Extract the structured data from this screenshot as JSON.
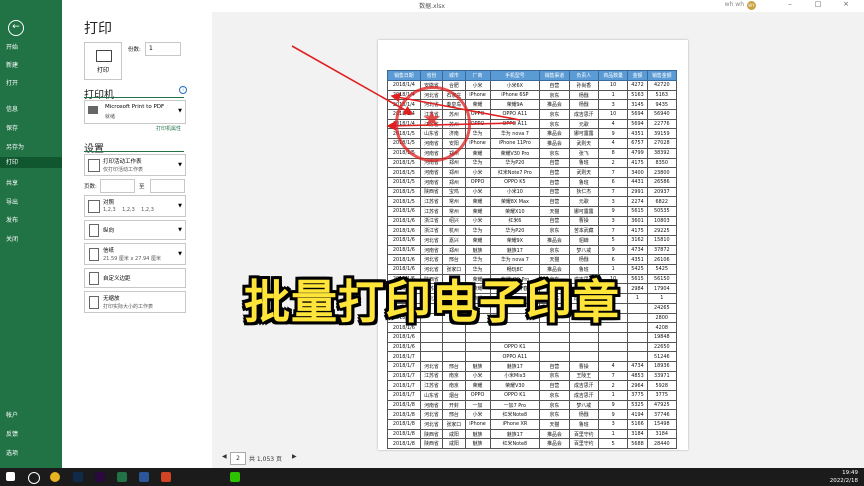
{
  "window": {
    "title": "数据.xlsx",
    "user": "wh wh",
    "avatar": "WY"
  },
  "sidebar": {
    "items": [
      "开始",
      "新建",
      "打开",
      "信息",
      "保存",
      "另存为",
      "打印",
      "共享",
      "导出",
      "发布",
      "关闭",
      "帐户",
      "反馈",
      "选项"
    ]
  },
  "print": {
    "title": "打印",
    "copies_label": "份数:",
    "copies_value": "1",
    "print_button": "打印",
    "printer_section": "打印机",
    "printer_name": "Microsoft Print to PDF",
    "printer_status": "就绪",
    "printer_props": "打印机属性",
    "settings_section": "设置",
    "setting1_main": "打印活动工作表",
    "setting1_sub": "仅打印活动工作表",
    "pages_label": "页数:",
    "pages_to": "至",
    "collate_main": "对照",
    "collate_sub": "1,2,3    1,2,3    1,2,3",
    "orientation": "纵向",
    "paper_main": "信纸",
    "paper_sub": "21.59 厘米 x 27.94 厘米",
    "margins": "自定义边距",
    "scale_main": "无缩放",
    "scale_sub": "打印实际大小的工作表"
  },
  "preview": {
    "page_current": "2",
    "page_total": "共 1,053 页",
    "headers": [
      "销售日期",
      "省份",
      "城市",
      "厂商",
      "手机型号",
      "销售渠道",
      "负责人",
      "商品数量",
      "金额",
      "销售金额"
    ],
    "rows": [
      [
        "2018/1/4",
        "安徽省",
        "合肥",
        "小米",
        "小米6X",
        "自营",
        "孙尚香",
        "10",
        "4272",
        "42720"
      ],
      [
        "2018/1/4",
        "河北省",
        "石家庄",
        "iPhone",
        "iPhone 6SP",
        "京东",
        "杨戬",
        "1",
        "5163",
        "5163"
      ],
      [
        "2018/1/4",
        "河北省",
        "秦皇岛",
        "荣耀",
        "荣耀9A",
        "推品会",
        "杨戬",
        "3",
        "3145",
        "9435"
      ],
      [
        "2018/1/4",
        "江苏省",
        "苏州",
        "OPPO",
        "OPPO A11",
        "京东",
        "成吉思汗",
        "10",
        "5694",
        "56940"
      ],
      [
        "2018/1/4",
        "江苏省",
        "苏州",
        "OPPO",
        "OPPO A11",
        "京东",
        "元歌",
        "4",
        "5694",
        "22776"
      ],
      [
        "2018/1/5",
        "山东省",
        "济南",
        "华为",
        "华为 nova 7",
        "推品会",
        "娜可露露",
        "9",
        "4351",
        "39159"
      ],
      [
        "2018/1/5",
        "河南省",
        "安阳",
        "iPhone",
        "iPhone 11Pro",
        "推品会",
        "武则天",
        "4",
        "6757",
        "27028"
      ],
      [
        "2018/1/5",
        "河南省",
        "郑州",
        "荣耀",
        "荣耀V30 Pro",
        "京东",
        "张飞",
        "8",
        "4799",
        "38392"
      ],
      [
        "2018/1/5",
        "河南省",
        "郑州",
        "华为",
        "华为P20",
        "自营",
        "鲁班",
        "2",
        "4175",
        "8350"
      ],
      [
        "2018/1/5",
        "河南省",
        "郑州",
        "小米",
        "红米Note7 Pro",
        "自营",
        "武则天",
        "7",
        "3400",
        "23800"
      ],
      [
        "2018/1/5",
        "河南省",
        "郑州",
        "OPPO",
        "OPPO K5",
        "自营",
        "鲁班",
        "6",
        "4431",
        "26586"
      ],
      [
        "2018/1/5",
        "陕西省",
        "宝鸡",
        "小米",
        "小米10",
        "自营",
        "狄仁杰",
        "7",
        "2991",
        "20937"
      ],
      [
        "2018/1/5",
        "江苏省",
        "常州",
        "荣耀",
        "荣耀8X Max",
        "自营",
        "元歌",
        "3",
        "2274",
        "6822"
      ],
      [
        "2018/1/6",
        "江苏省",
        "常州",
        "荣耀",
        "荣耀X10",
        "天猫",
        "娜可露露",
        "9",
        "5615",
        "50535"
      ],
      [
        "2018/1/6",
        "浙江省",
        "绍兴",
        "小米",
        "红米6",
        "自营",
        "曹操",
        "3",
        "3601",
        "10803"
      ],
      [
        "2018/1/6",
        "浙江省",
        "杭州",
        "华为",
        "华为P20",
        "京东",
        "苦本武藏",
        "7",
        "4175",
        "29225"
      ],
      [
        "2018/1/6",
        "河北省",
        "嘉兴",
        "荣耀",
        "荣耀9X",
        "推品会",
        "貂蝉",
        "5",
        "3162",
        "15810"
      ],
      [
        "2018/1/6",
        "河南省",
        "郑州",
        "魅族",
        "魅族17",
        "京东",
        "梦八戒",
        "9",
        "4734",
        "37872"
      ],
      [
        "2018/1/6",
        "河北省",
        "邢台",
        "华为",
        "华为 nova 7",
        "天猫",
        "杨戬",
        "6",
        "4351",
        "26106"
      ],
      [
        "2018/1/6",
        "河北省",
        "张家口",
        "华为",
        "畅玩8C",
        "推品会",
        "鲁班",
        "1",
        "5425",
        "5425"
      ],
      [
        "2018/1/6",
        "陕西省",
        "西安",
        "荣耀",
        "荣耀V30 Pro",
        "京东",
        "成吉思汗",
        "10",
        "5615",
        "56150"
      ],
      [
        "2018/1/6",
        "江苏省",
        "常州",
        "荣耀",
        "荣耀20青春",
        "自营",
        "成吉思汗",
        "6",
        "2984",
        "17904"
      ],
      [
        "2018/1/6",
        "河北省",
        "连云港",
        "荣耀",
        "红魔3",
        "京东",
        "成吉思汗",
        "6",
        "1",
        "1"
      ],
      [
        "2018/1/6",
        "",
        "",
        "",
        "",
        "",
        "",
        "",
        "",
        "24265"
      ],
      [
        "2018/1/6",
        "",
        "",
        "",
        "",
        "",
        "",
        "",
        "",
        "2800"
      ],
      [
        "2018/1/6",
        "",
        "",
        "",
        "",
        "",
        "",
        "",
        "",
        "4208"
      ],
      [
        "2018/1/6",
        "",
        "",
        "",
        "",
        "",
        "",
        "",
        "",
        "19848"
      ],
      [
        "2018/1/6",
        "",
        "",
        "",
        "OPPO K1",
        "",
        "",
        "",
        "",
        "22650"
      ],
      [
        "2018/1/7",
        "",
        "",
        "",
        "OPPO A11",
        "",
        "",
        "",
        "",
        "51246"
      ],
      [
        "2018/1/7",
        "河北省",
        "邢台",
        "魅族",
        "魅族17",
        "自营",
        "曹操",
        "4",
        "4734",
        "18936"
      ],
      [
        "2018/1/7",
        "江苏省",
        "南京",
        "小米",
        "小米Mix3",
        "京东",
        "王陵王",
        "7",
        "4853",
        "33971"
      ],
      [
        "2018/1/7",
        "江苏省",
        "南京",
        "荣耀",
        "荣耀V30",
        "自营",
        "成吉思汗",
        "2",
        "2964",
        "5928"
      ],
      [
        "2018/1/7",
        "山东省",
        "烟台",
        "OPPO",
        "OPPO K1",
        "京东",
        "成吉思汗",
        "1",
        "3775",
        "3775"
      ],
      [
        "2018/1/8",
        "河南省",
        "开封",
        "一加",
        "一加7 Pro",
        "京东",
        "梦八戒",
        "9",
        "5325",
        "47925"
      ],
      [
        "2018/1/8",
        "河北省",
        "邢台",
        "小米",
        "红米Note8",
        "京东",
        "杨戬",
        "9",
        "4194",
        "37746"
      ],
      [
        "2018/1/8",
        "河北省",
        "张家口",
        "iPhone",
        "iPhone XR",
        "天猫",
        "鲁班",
        "3",
        "5166",
        "15498"
      ],
      [
        "2018/1/8",
        "陕西省",
        "咸阳",
        "魅族",
        "魅族17",
        "推品会",
        "百里守约",
        "1",
        "3184",
        "3184"
      ],
      [
        "2018/1/8",
        "陕西省",
        "咸阳",
        "魅族",
        "红米Note8",
        "推品会",
        "百里守约",
        "5",
        "5688",
        "28440"
      ]
    ]
  },
  "banner": "批量打印电子印章",
  "taskbar": {
    "time": "19:49",
    "date": "2022/2/18"
  },
  "colors": {
    "excel_green": "#217346",
    "banner": "#ffe43a",
    "stamp": "#dc1e1e",
    "arrow": "#e02020",
    "header": "#5b9bd5"
  }
}
